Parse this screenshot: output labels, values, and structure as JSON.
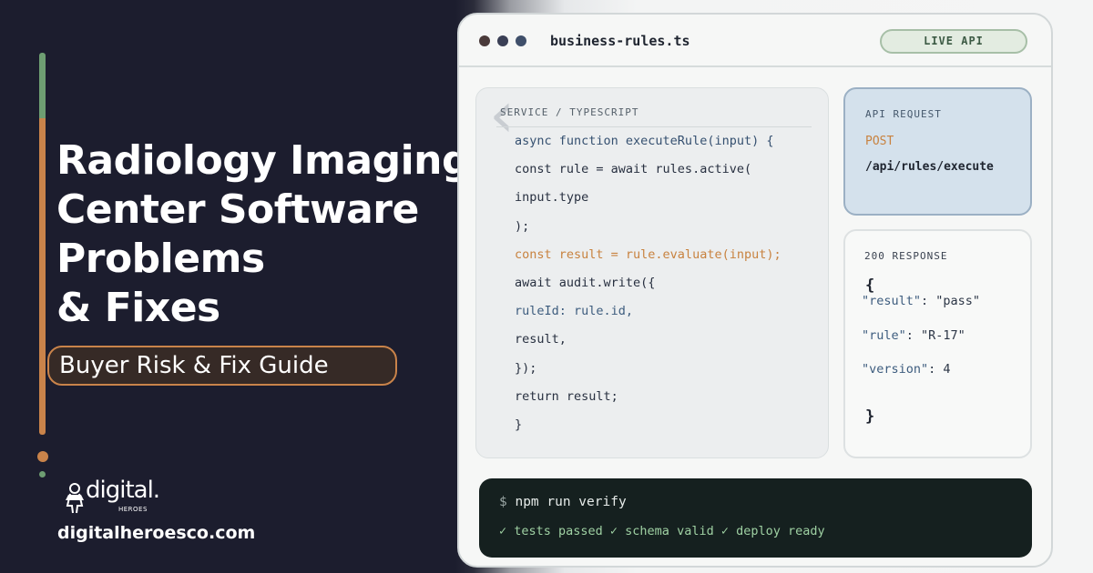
{
  "hero": {
    "title_lines": [
      "Radiology Imaging",
      "Center Software",
      "Problems",
      "& Fixes"
    ],
    "subtitle": "Buyer Risk & Fix Guide"
  },
  "brand": {
    "logo_word": "digital.",
    "logo_sub": "HEROES",
    "url": "digitalheroesco.com"
  },
  "editor": {
    "filename": "business-rules.ts",
    "badge": "LIVE API",
    "code_label": "SERVICE / TYPESCRIPT",
    "code_lines": [
      "async function executeRule(input) {",
      "const rule = await rules.active(",
      "input.type",
      ");",
      "const result = rule.evaluate(input);",
      "await audit.write({",
      "ruleId: rule.id,",
      "result,",
      "});",
      "return result;",
      "}"
    ]
  },
  "api_request": {
    "label": "API REQUEST",
    "method": "POST",
    "path": "/api/rules/execute"
  },
  "api_response": {
    "label": "200 RESPONSE",
    "open_brace": "{",
    "lines": [
      {
        "key": "\"result\"",
        "sep": ": ",
        "value": "\"pass\""
      },
      {
        "key": "\"rule\"",
        "sep": ": ",
        "value": "\"R-17\""
      },
      {
        "key": "\"version\"",
        "sep": ": ",
        "value": "4"
      }
    ],
    "close_brace": "}"
  },
  "terminal": {
    "prompt": "$",
    "command": "npm run verify",
    "output": "✓ tests passed ✓ schema valid ✓ deploy ready"
  },
  "colors": {
    "accent_orange": "#c9834a",
    "accent_green": "#6e9e72",
    "dark_bg": "#1c1d2e"
  }
}
